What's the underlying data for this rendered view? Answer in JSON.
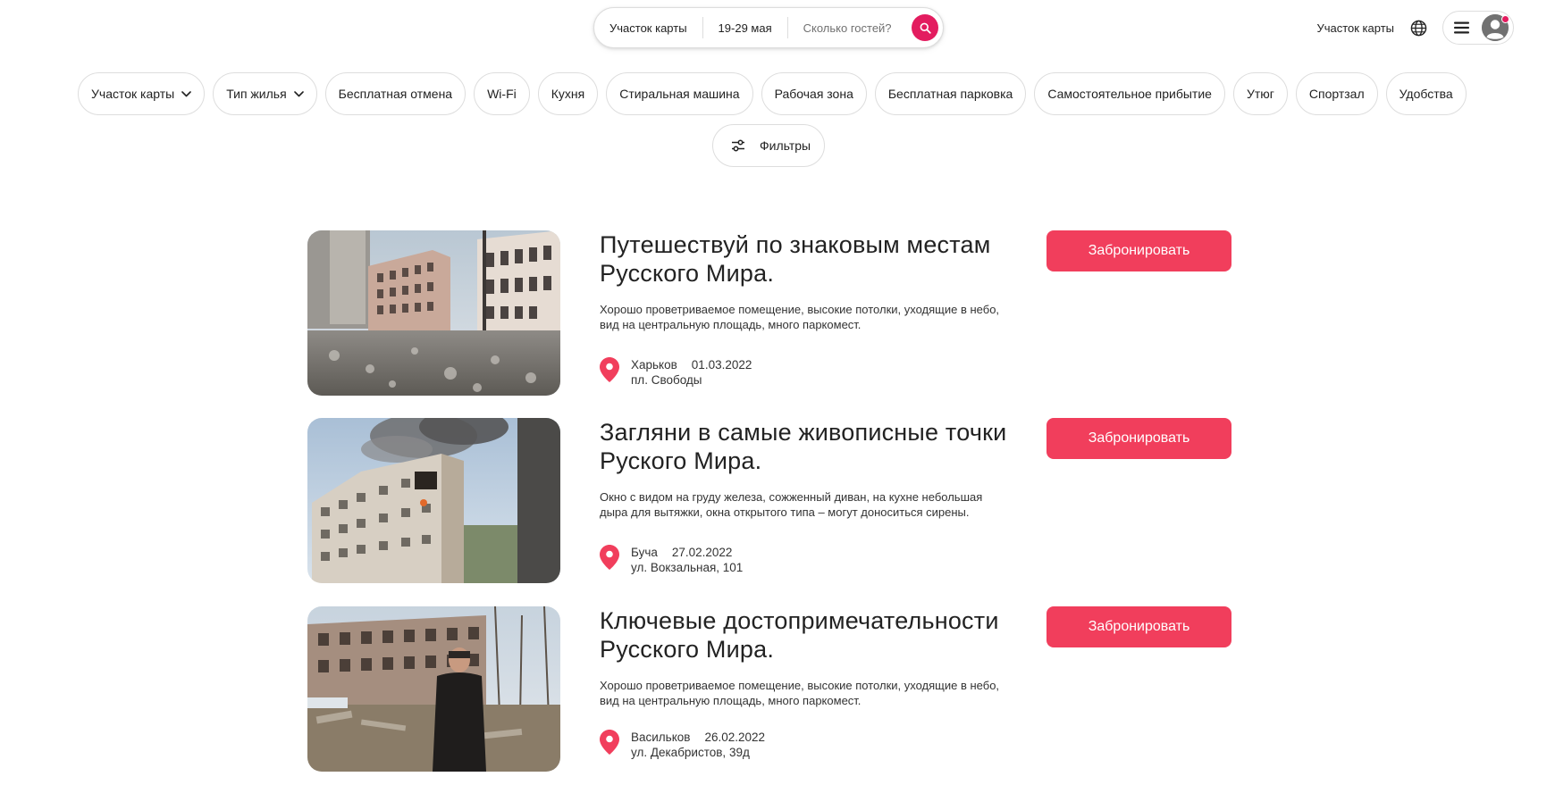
{
  "search": {
    "location": "Участок карты",
    "dates": "19-29 мая",
    "guests_placeholder": "Сколько гостей?"
  },
  "header": {
    "host_link": "Участок карты",
    "icons": [
      "globe-icon",
      "menu-icon",
      "avatar-icon"
    ]
  },
  "colors": {
    "accent": "#e31c5f",
    "button": "#f13e5c",
    "border": "#dddddd"
  },
  "chips": [
    {
      "label": "Участок карты",
      "dropdown": true
    },
    {
      "label": "Тип жилья",
      "dropdown": true
    },
    {
      "label": "Бесплатная отмена"
    },
    {
      "label": "Wi-Fi"
    },
    {
      "label": "Кухня"
    },
    {
      "label": "Стиральная машина"
    },
    {
      "label": "Рабочая зона"
    },
    {
      "label": "Бесплатная парковка"
    },
    {
      "label": "Самостоятельное прибытие"
    },
    {
      "label": "Утюг"
    },
    {
      "label": "Спортзал"
    },
    {
      "label": "Удобства"
    }
  ],
  "filters": {
    "label": "Фильтры"
  },
  "listings": [
    {
      "title": "Путешествуй по знаковым местам Русского Мира.",
      "description": "Хорошо проветриваемое помещение, высокие потолки, уходящие в небо, вид на центральную площадь, много паркомест.",
      "city": "Харьков",
      "date": "01.03.2022",
      "address": "пл. Свободы",
      "button": "Забронировать"
    },
    {
      "title": "Загляни в самые живописные точки Руского Мира.",
      "description": "Окно с видом на груду железа, сожженный диван, на кухне небольшая дыра для вытяжки, окна открытого типа – могут доноситься сирены.",
      "city": "Буча",
      "date": "27.02.2022",
      "address": "ул. Вокзальная, 101",
      "button": "Забронировать"
    },
    {
      "title": "Ключевые достопримечательности Русского Мира.",
      "description": "Хорошо проветриваемое помещение, высокие потолки, уходящие в небо, вид на центральную площадь, много паркомест.",
      "city": "Васильков",
      "date": "26.02.2022",
      "address": "ул. Декабристов, 39д",
      "button": "Забронировать"
    }
  ]
}
